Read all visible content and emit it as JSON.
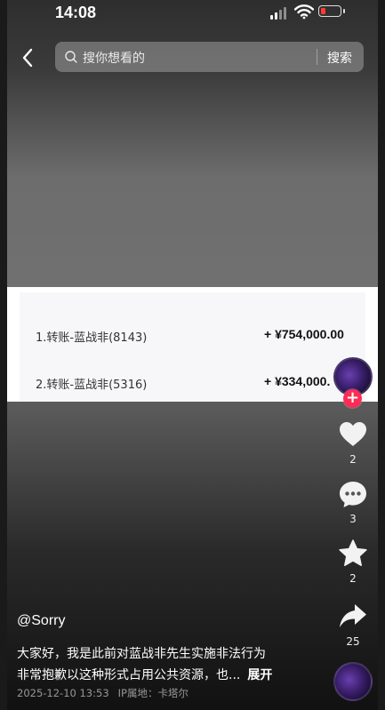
{
  "status_bar": {
    "time": "14:08"
  },
  "header": {
    "back_icon": "chevron-left-icon",
    "search_placeholder": "搜你想看的",
    "search_button": "搜索"
  },
  "content_image": {
    "rows": [
      {
        "name": "1.转账-蓝战非(8143)",
        "amount": "+ ¥754,000.00"
      },
      {
        "name": "2.转账-蓝战非(5316)",
        "amount": "+ ¥334,000."
      }
    ]
  },
  "actions": {
    "follow_label": "+",
    "like_count": "2",
    "comment_count": "3",
    "favorite_count": "2",
    "share_count": "25"
  },
  "caption": {
    "author": "@Sorry",
    "line1": "大家好，我是此前对蓝战非先生实施非法行为",
    "line2": "非常抱歉以这种形式占用公共资源，也...",
    "expand": "展开",
    "date": "2025-12-10 13:53",
    "ip_location": "IP属地：卡塔尔"
  },
  "colors": {
    "accent": "#fe2c55",
    "battery_low": "#ff3b30"
  }
}
